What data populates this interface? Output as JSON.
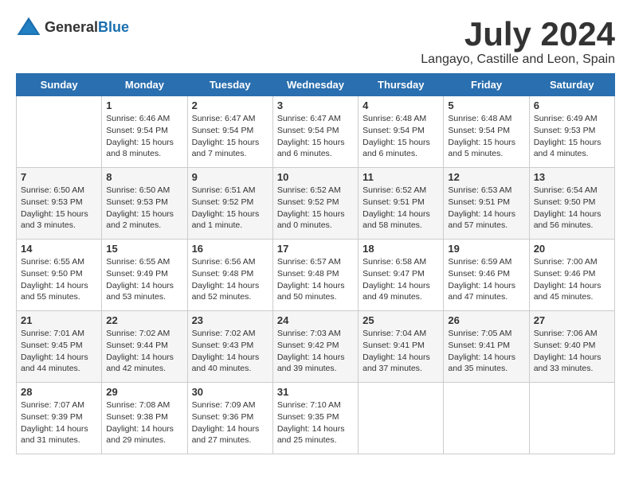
{
  "logo": {
    "general": "General",
    "blue": "Blue"
  },
  "title": "July 2024",
  "location": "Langayo, Castille and Leon, Spain",
  "days_header": [
    "Sunday",
    "Monday",
    "Tuesday",
    "Wednesday",
    "Thursday",
    "Friday",
    "Saturday"
  ],
  "weeks": [
    [
      {
        "day": "",
        "content": ""
      },
      {
        "day": "1",
        "content": "Sunrise: 6:46 AM\nSunset: 9:54 PM\nDaylight: 15 hours\nand 8 minutes."
      },
      {
        "day": "2",
        "content": "Sunrise: 6:47 AM\nSunset: 9:54 PM\nDaylight: 15 hours\nand 7 minutes."
      },
      {
        "day": "3",
        "content": "Sunrise: 6:47 AM\nSunset: 9:54 PM\nDaylight: 15 hours\nand 6 minutes."
      },
      {
        "day": "4",
        "content": "Sunrise: 6:48 AM\nSunset: 9:54 PM\nDaylight: 15 hours\nand 6 minutes."
      },
      {
        "day": "5",
        "content": "Sunrise: 6:48 AM\nSunset: 9:54 PM\nDaylight: 15 hours\nand 5 minutes."
      },
      {
        "day": "6",
        "content": "Sunrise: 6:49 AM\nSunset: 9:53 PM\nDaylight: 15 hours\nand 4 minutes."
      }
    ],
    [
      {
        "day": "7",
        "content": "Sunrise: 6:50 AM\nSunset: 9:53 PM\nDaylight: 15 hours\nand 3 minutes."
      },
      {
        "day": "8",
        "content": "Sunrise: 6:50 AM\nSunset: 9:53 PM\nDaylight: 15 hours\nand 2 minutes."
      },
      {
        "day": "9",
        "content": "Sunrise: 6:51 AM\nSunset: 9:52 PM\nDaylight: 15 hours\nand 1 minute."
      },
      {
        "day": "10",
        "content": "Sunrise: 6:52 AM\nSunset: 9:52 PM\nDaylight: 15 hours\nand 0 minutes."
      },
      {
        "day": "11",
        "content": "Sunrise: 6:52 AM\nSunset: 9:51 PM\nDaylight: 14 hours\nand 58 minutes."
      },
      {
        "day": "12",
        "content": "Sunrise: 6:53 AM\nSunset: 9:51 PM\nDaylight: 14 hours\nand 57 minutes."
      },
      {
        "day": "13",
        "content": "Sunrise: 6:54 AM\nSunset: 9:50 PM\nDaylight: 14 hours\nand 56 minutes."
      }
    ],
    [
      {
        "day": "14",
        "content": "Sunrise: 6:55 AM\nSunset: 9:50 PM\nDaylight: 14 hours\nand 55 minutes."
      },
      {
        "day": "15",
        "content": "Sunrise: 6:55 AM\nSunset: 9:49 PM\nDaylight: 14 hours\nand 53 minutes."
      },
      {
        "day": "16",
        "content": "Sunrise: 6:56 AM\nSunset: 9:48 PM\nDaylight: 14 hours\nand 52 minutes."
      },
      {
        "day": "17",
        "content": "Sunrise: 6:57 AM\nSunset: 9:48 PM\nDaylight: 14 hours\nand 50 minutes."
      },
      {
        "day": "18",
        "content": "Sunrise: 6:58 AM\nSunset: 9:47 PM\nDaylight: 14 hours\nand 49 minutes."
      },
      {
        "day": "19",
        "content": "Sunrise: 6:59 AM\nSunset: 9:46 PM\nDaylight: 14 hours\nand 47 minutes."
      },
      {
        "day": "20",
        "content": "Sunrise: 7:00 AM\nSunset: 9:46 PM\nDaylight: 14 hours\nand 45 minutes."
      }
    ],
    [
      {
        "day": "21",
        "content": "Sunrise: 7:01 AM\nSunset: 9:45 PM\nDaylight: 14 hours\nand 44 minutes."
      },
      {
        "day": "22",
        "content": "Sunrise: 7:02 AM\nSunset: 9:44 PM\nDaylight: 14 hours\nand 42 minutes."
      },
      {
        "day": "23",
        "content": "Sunrise: 7:02 AM\nSunset: 9:43 PM\nDaylight: 14 hours\nand 40 minutes."
      },
      {
        "day": "24",
        "content": "Sunrise: 7:03 AM\nSunset: 9:42 PM\nDaylight: 14 hours\nand 39 minutes."
      },
      {
        "day": "25",
        "content": "Sunrise: 7:04 AM\nSunset: 9:41 PM\nDaylight: 14 hours\nand 37 minutes."
      },
      {
        "day": "26",
        "content": "Sunrise: 7:05 AM\nSunset: 9:41 PM\nDaylight: 14 hours\nand 35 minutes."
      },
      {
        "day": "27",
        "content": "Sunrise: 7:06 AM\nSunset: 9:40 PM\nDaylight: 14 hours\nand 33 minutes."
      }
    ],
    [
      {
        "day": "28",
        "content": "Sunrise: 7:07 AM\nSunset: 9:39 PM\nDaylight: 14 hours\nand 31 minutes."
      },
      {
        "day": "29",
        "content": "Sunrise: 7:08 AM\nSunset: 9:38 PM\nDaylight: 14 hours\nand 29 minutes."
      },
      {
        "day": "30",
        "content": "Sunrise: 7:09 AM\nSunset: 9:36 PM\nDaylight: 14 hours\nand 27 minutes."
      },
      {
        "day": "31",
        "content": "Sunrise: 7:10 AM\nSunset: 9:35 PM\nDaylight: 14 hours\nand 25 minutes."
      },
      {
        "day": "",
        "content": ""
      },
      {
        "day": "",
        "content": ""
      },
      {
        "day": "",
        "content": ""
      }
    ]
  ]
}
